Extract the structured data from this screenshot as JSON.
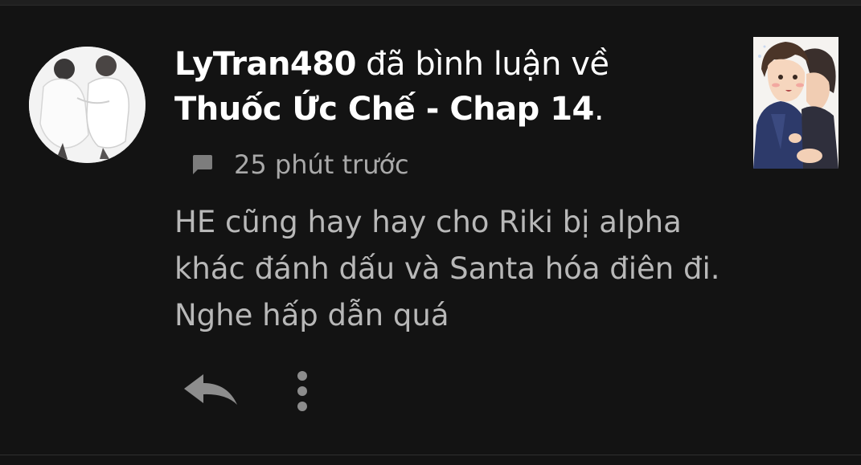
{
  "notification": {
    "username": "LyTran480",
    "action_text": " đã bình luận về",
    "target_title": "Thuốc Ức Chế - Chap 14",
    "target_suffix": ".",
    "time_ago": "25 phút trước",
    "comment_text": "HE cũng hay hay cho Riki bị alpha khác đánh dấu và Santa hóa điên đi. Nghe hấp dẫn quá"
  },
  "icons": {
    "meta": "chat-bubble-icon",
    "reply": "reply-icon",
    "more": "more-vertical-icon"
  },
  "colors": {
    "background": "#131313",
    "primary_text": "#ffffff",
    "secondary_text": "#a9a9a9",
    "comment_text": "#b8b8b8",
    "icon": "#8a8a8a"
  }
}
